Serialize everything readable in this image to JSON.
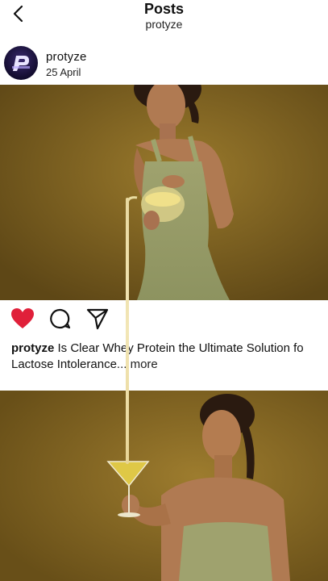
{
  "header": {
    "title": "Posts",
    "subtitle": "protyze"
  },
  "post": {
    "username": "protyze",
    "date": "25 April",
    "caption_user": "protyze",
    "caption_line1": " Is Clear Whey Protein the Ultimate Solution fo",
    "caption_line2": "Lactose Intolerance",
    "more_label": "... more",
    "liked": true,
    "colors": {
      "like": "#e0203a",
      "accent": "#111111"
    }
  },
  "icons": {
    "back": "chevron-left-icon",
    "like": "heart-icon",
    "comment": "comment-icon",
    "share": "paper-plane-icon",
    "avatar": "protyze-logo"
  }
}
